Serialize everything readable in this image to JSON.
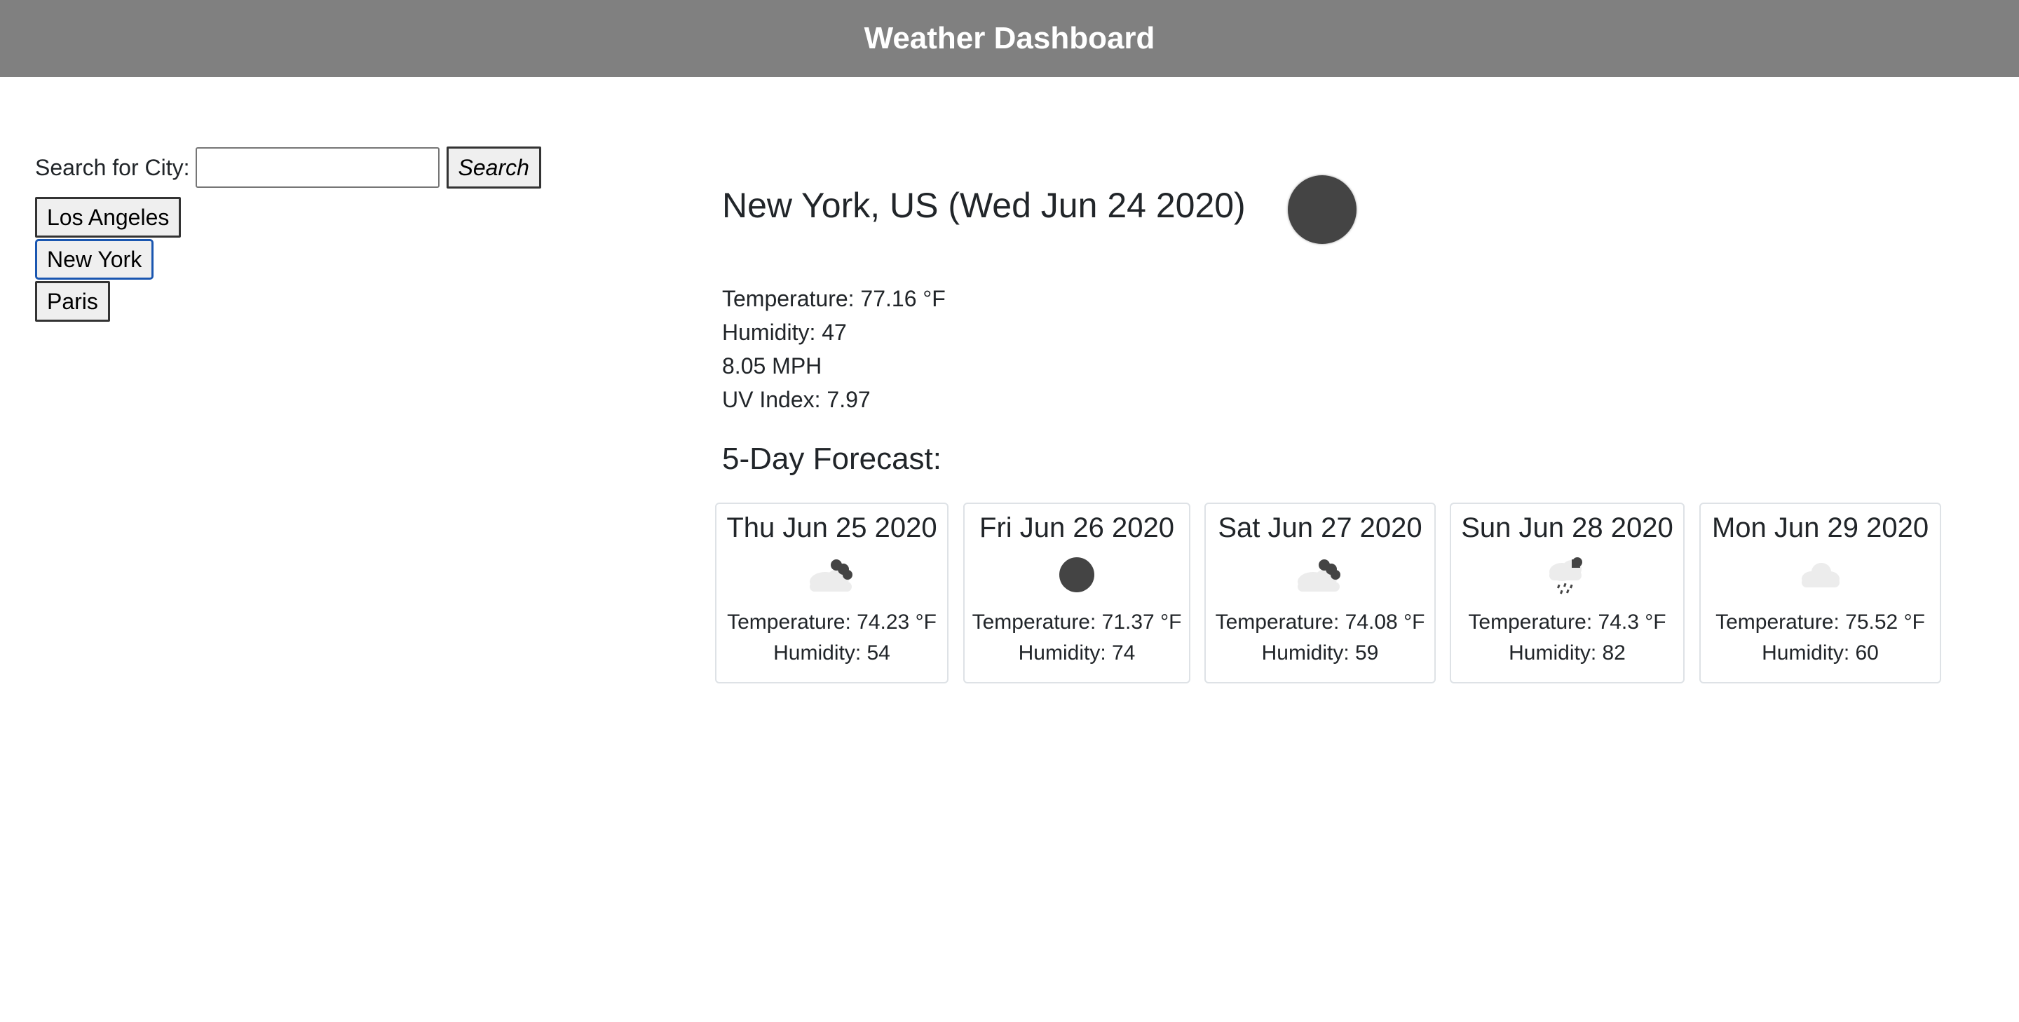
{
  "header": {
    "title": "Weather Dashboard"
  },
  "search": {
    "label": "Search for City:",
    "input_value": "",
    "button_label": "Search"
  },
  "cities": [
    {
      "label": "Los Angeles"
    },
    {
      "label": "New York",
      "active": true
    },
    {
      "label": "Paris"
    }
  ],
  "current": {
    "title": "New York, US (Wed Jun 24 2020)",
    "icon": "clear-sky-icon",
    "temperature": "Temperature: 77.16 °F",
    "humidity": "Humidity: 47",
    "wind": "8.05 MPH",
    "uv": "UV Index: 7.97"
  },
  "forecast": {
    "title": "5-Day Forecast:",
    "days": [
      {
        "date": "Thu Jun 25 2020",
        "icon": "partly-cloudy-icon",
        "temperature": "Temperature: 74.23 °F",
        "humidity": "Humidity: 54"
      },
      {
        "date": "Fri Jun 26 2020",
        "icon": "clear-sky-icon",
        "temperature": "Temperature: 71.37 °F",
        "humidity": "Humidity: 74"
      },
      {
        "date": "Sat Jun 27 2020",
        "icon": "partly-cloudy-icon",
        "temperature": "Temperature: 74.08 °F",
        "humidity": "Humidity: 59"
      },
      {
        "date": "Sun Jun 28 2020",
        "icon": "rain-icon",
        "temperature": "Temperature: 74.3 °F",
        "humidity": "Humidity: 82"
      },
      {
        "date": "Mon Jun 29 2020",
        "icon": "cloud-icon",
        "temperature": "Temperature: 75.52 °F",
        "humidity": "Humidity: 60"
      }
    ]
  },
  "colors": {
    "header_bg": "#808080",
    "active_border": "#1a56b0",
    "icon_dark": "#444444",
    "cloud": "#ececec"
  }
}
